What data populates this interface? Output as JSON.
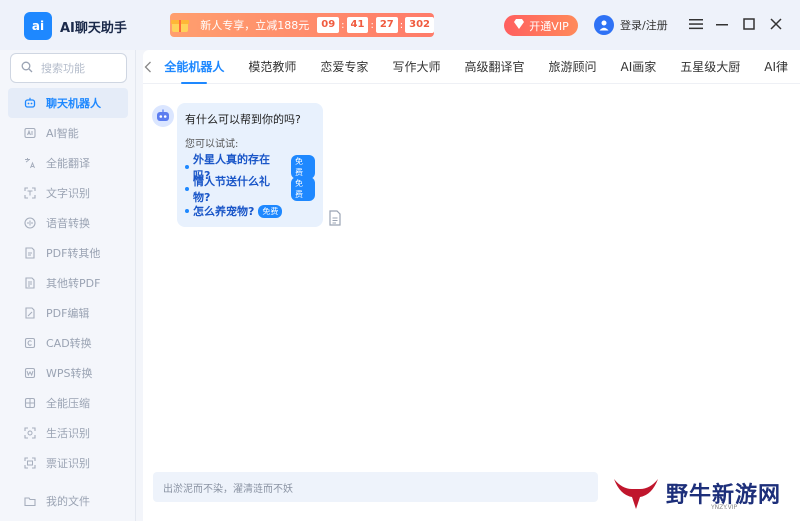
{
  "app": {
    "logo_text": "ai",
    "title": "AI聊天助手"
  },
  "promo": {
    "text": "新人专享，立减188元",
    "timer": [
      "09",
      "41",
      "27",
      "302"
    ]
  },
  "header": {
    "vip_label": "开通VIP",
    "login_label": "登录/注册"
  },
  "sidebar": {
    "search_placeholder": "搜索功能",
    "items": [
      {
        "label": "聊天机器人",
        "icon": "robot-icon",
        "active": true
      },
      {
        "label": "AI智能",
        "icon": "ai-icon"
      },
      {
        "label": "全能翻译",
        "icon": "translate-icon"
      },
      {
        "label": "文字识别",
        "icon": "scan-text-icon"
      },
      {
        "label": "语音转换",
        "icon": "voice-icon"
      },
      {
        "label": "PDF转其他",
        "icon": "pdf-convert-icon"
      },
      {
        "label": "其他转PDF",
        "icon": "to-pdf-icon"
      },
      {
        "label": "PDF编辑",
        "icon": "pdf-edit-icon"
      },
      {
        "label": "CAD转换",
        "icon": "cad-icon"
      },
      {
        "label": "WPS转换",
        "icon": "wps-icon"
      },
      {
        "label": "全能压缩",
        "icon": "compress-icon"
      },
      {
        "label": "生活识别",
        "icon": "life-scan-icon"
      },
      {
        "label": "票证识别",
        "icon": "ticket-scan-icon"
      }
    ],
    "bottom_item": {
      "label": "我的文件",
      "icon": "folder-icon"
    }
  },
  "tabs": [
    "全能机器人",
    "模范教师",
    "恋爱专家",
    "写作大师",
    "高级翻译官",
    "旅游顾问",
    "AI画家",
    "五星级大厨",
    "AI律"
  ],
  "chat": {
    "question": "有什么可以帮到你的吗?",
    "hint": "您可以试试:",
    "free_badge": "免费",
    "suggestions": [
      "外星人真的存在吗?",
      "情人节送什么礼物?",
      "怎么养宠物?"
    ]
  },
  "input": {
    "placeholder": "出淤泥而不染，濯清涟而不妖"
  },
  "watermark": {
    "text": "野牛新游网",
    "sub": "YNZY.VIP"
  },
  "colors": {
    "accent": "#1e88ff",
    "promo": "#ff8a6a",
    "vip": "#ff6a5a"
  }
}
